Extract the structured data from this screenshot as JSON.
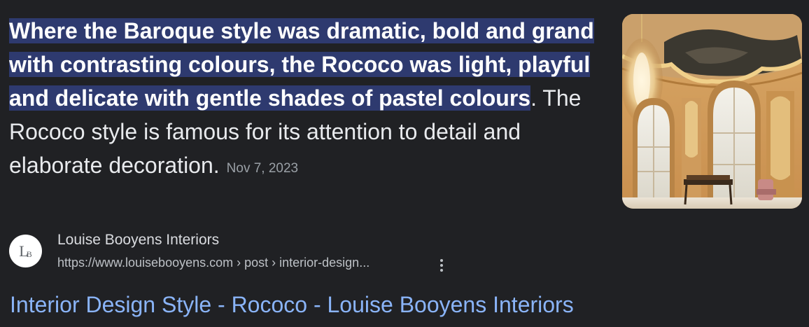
{
  "snippet": {
    "highlighted": "Where the Baroque style was dramatic, bold and grand with contrasting colours, the Rococo was light, playful and delicate with gentle shades of pastel colours",
    "rest": ". The Rococo style is famous for its attention to detail and elaborate decoration.",
    "date": "Nov 7, 2023"
  },
  "thumbnail": {
    "icon": "rococo-interior-image"
  },
  "source": {
    "favicon_text": "L",
    "favicon_sub": "B",
    "site_name": "Louise Booyens Interiors",
    "url": "https://www.louisebooyens.com › post › interior-design...",
    "more_icon": "three-dots-vertical-icon"
  },
  "result": {
    "title": "Interior Design Style - Rococo - Louise Booyens Interiors"
  },
  "colors": {
    "background": "#202124",
    "highlight": "#2e3a6f",
    "link": "#8ab4f8",
    "text": "#e8eaed",
    "muted": "#9aa0a6"
  }
}
